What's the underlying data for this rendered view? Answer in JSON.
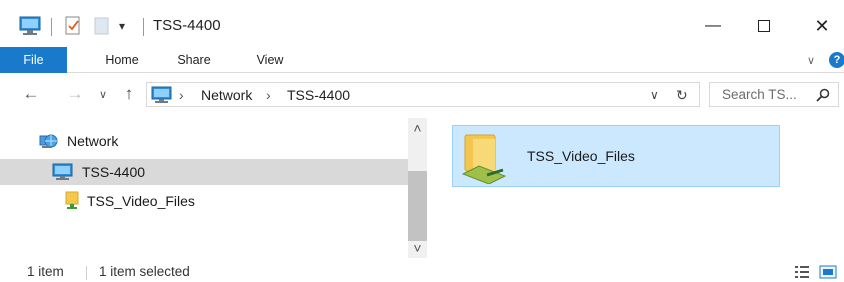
{
  "window": {
    "title": "TSS-4400",
    "minimize_glyph": "—",
    "maximize_glyph": "☐",
    "close_glyph": "✕"
  },
  "quick_access": {
    "dropdown_glyph": "▾"
  },
  "ribbon": {
    "tabs": [
      {
        "label": "File",
        "active": true
      },
      {
        "label": "Home"
      },
      {
        "label": "Share"
      },
      {
        "label": "View"
      }
    ],
    "expand_glyph": "∨",
    "help_glyph": "?"
  },
  "navigation": {
    "back_glyph": "←",
    "forward_glyph": "→",
    "recent_glyph": "∨",
    "up_glyph": "↑"
  },
  "address": {
    "crumbs": [
      "Network",
      "TSS-4400"
    ],
    "separator": "›",
    "dropdown_glyph": "∨",
    "refresh_glyph": "↻"
  },
  "search": {
    "placeholder": "Search TS..."
  },
  "nav_pane": {
    "items": [
      {
        "label": "Network",
        "icon": "network-icon"
      },
      {
        "label": "TSS-4400",
        "icon": "computer-icon",
        "selected": true
      },
      {
        "label": "TSS_Video_Files",
        "icon": "shared-folder-icon"
      }
    ],
    "scroll_up_glyph": "˄",
    "scroll_down_glyph": "˅"
  },
  "content": {
    "items": [
      {
        "name": "TSS_Video_Files",
        "icon": "network-share-folder-icon",
        "selected": true
      }
    ]
  },
  "status": {
    "item_count": "1 item",
    "selection": "1 item selected"
  },
  "colors": {
    "accent": "#1979ca",
    "selection_fill": "#cce8ff",
    "selection_border": "#99d1ff",
    "nav_selected": "#d9d9d9"
  }
}
